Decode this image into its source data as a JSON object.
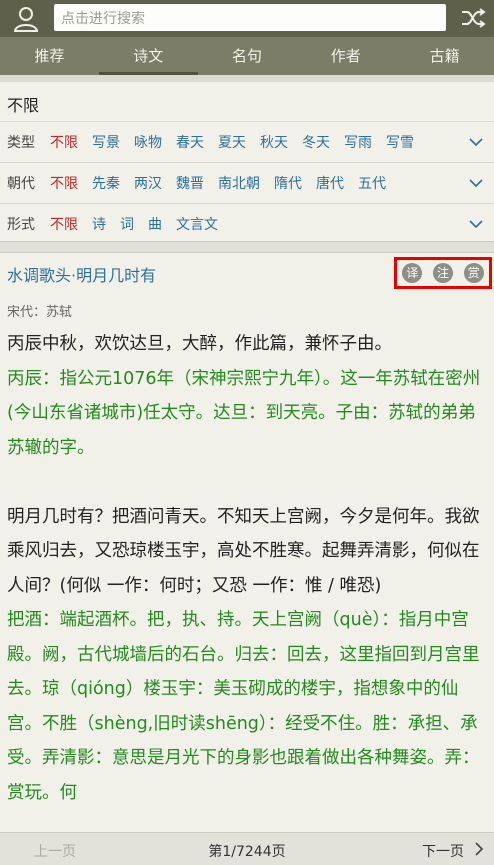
{
  "search": {
    "placeholder": "点击进行搜索"
  },
  "tabs": [
    "推荐",
    "诗文",
    "名句",
    "作者",
    "古籍"
  ],
  "filter": {
    "title": "不限",
    "rows": [
      {
        "label": "类型",
        "options": [
          "不限",
          "写景",
          "咏物",
          "春天",
          "夏天",
          "秋天",
          "冬天",
          "写雨",
          "写雪"
        ]
      },
      {
        "label": "朝代",
        "options": [
          "不限",
          "先秦",
          "两汉",
          "魏晋",
          "南北朝",
          "隋代",
          "唐代",
          "五代"
        ]
      },
      {
        "label": "形式",
        "options": [
          "不限",
          "诗",
          "词",
          "曲",
          "文言文"
        ]
      }
    ]
  },
  "poem": {
    "title": "水调歌头·明月几时有",
    "tools": [
      "译",
      "注",
      "赏"
    ],
    "meta": "宋代：苏轼",
    "preface": "丙辰中秋，欢饮达旦，大醉，作此篇，兼怀子由。",
    "preface_note": "丙辰：指公元1076年（宋神宗熙宁九年）。这一年苏轼在密州(今山东省诸城市)任太守。达旦：到天亮。子由：苏轼的弟弟苏辙的字。",
    "body": "明月几时有？把酒问青天。不知天上宫阙，今夕是何年。我欲乘风归去，又恐琼楼玉宇，高处不胜寒。起舞弄清影，何似在人间？(何似 一作：何时；又恐 一作：惟 / 唯恐)",
    "body_note": "把酒：端起酒杯。把，执、持。天上宫阙（què）：指月中宫殿。阙，古代城墙后的石台。归去：回去，这里指回到月宫里去。琼（qióng）楼玉宇：美玉砌成的楼宇，指想象中的仙宫。不胜（shèng,旧时读shēng）：经受不住。胜：承担、承受。弄清影：意思是月光下的身影也跟着做出各种舞姿。弄：赏玩。何"
  },
  "footer": {
    "prev": "上一页",
    "page": "第1/7244页",
    "next": "下一页"
  },
  "colors": {
    "topbar": "#5f604c",
    "tabs": "#7c7d69",
    "link": "#2c6f9e",
    "selected": "#c42626",
    "note": "#248a1e",
    "highlight": "#e60000"
  }
}
